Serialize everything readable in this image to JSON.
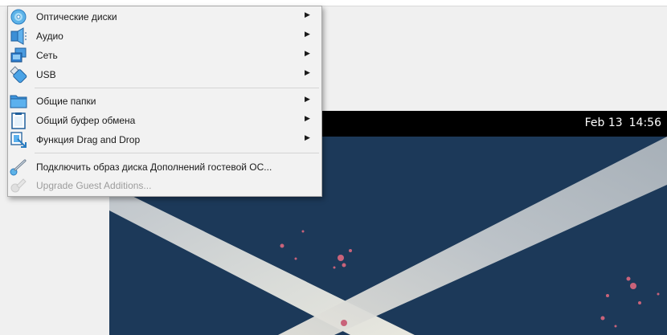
{
  "menu": {
    "items": [
      {
        "label": "Оптические диски",
        "icon": "optical-disc-icon",
        "submenu": true
      },
      {
        "label": "Аудио",
        "icon": "audio-icon",
        "submenu": true
      },
      {
        "label": "Сеть",
        "icon": "network-icon",
        "submenu": true
      },
      {
        "label": "USB",
        "icon": "usb-icon",
        "submenu": true
      },
      {
        "label": "Общие папки",
        "icon": "shared-folder-icon",
        "submenu": true
      },
      {
        "label": "Общий буфер обмена",
        "icon": "clipboard-icon",
        "submenu": true
      },
      {
        "label": "Функция Drag and Drop",
        "icon": "drag-drop-icon",
        "submenu": true
      },
      {
        "label": "Подключить образ диска Дополнений гостевой ОС...",
        "icon": "insert-guest-additions-icon",
        "submenu": false
      },
      {
        "label": "Upgrade Guest Additions...",
        "icon": "upgrade-guest-additions-icon",
        "submenu": false,
        "disabled": true
      }
    ],
    "submenu_arrow": "▶"
  },
  "guest": {
    "date": "Feb 13",
    "time": "14:56"
  },
  "colors": {
    "wallpaper": "#1c3959",
    "menu_bg": "#f2f2f2",
    "disabled_text": "#9c9c9c"
  }
}
